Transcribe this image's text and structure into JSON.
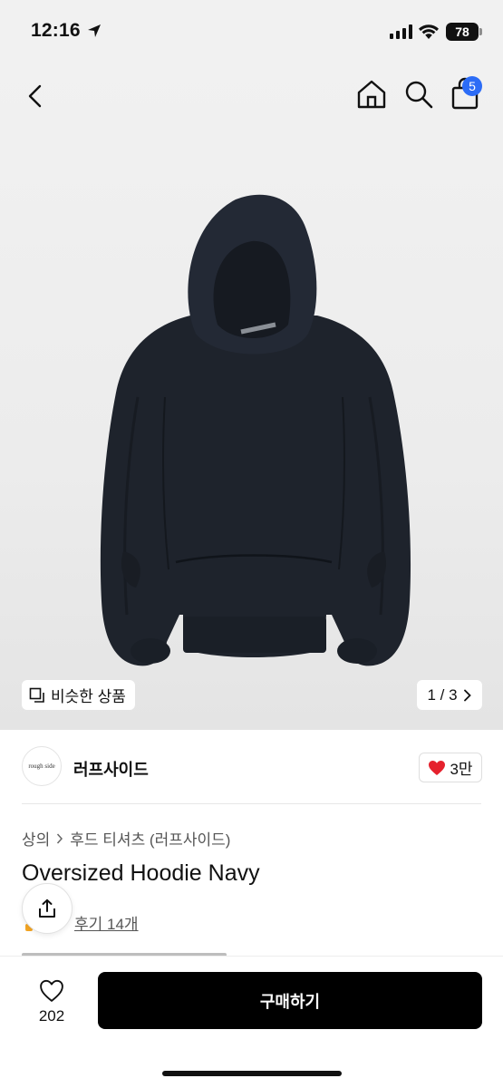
{
  "status_bar": {
    "time": "12:16",
    "battery": "78"
  },
  "nav": {
    "cart_count": "5"
  },
  "gallery": {
    "similar_label": "비슷한 상품",
    "page_indicator": "1 / 3"
  },
  "store": {
    "logo_text": "rough side",
    "name": "러프사이드",
    "likes": "3만"
  },
  "product": {
    "breadcrumb": [
      "상의",
      "후드 티셔츠 (러프사이드)"
    ],
    "title": "Oversized Hoodie Navy",
    "review_link": "후기 14개"
  },
  "bottom_bar": {
    "wish_count": "202",
    "buy_label": "구매하기"
  },
  "colors": {
    "accent_blue": "#2c6cf6",
    "heart_red": "#e5212d",
    "hoodie_navy": "#1e232c",
    "buy_button": "#000000"
  },
  "icons": [
    "back-icon",
    "home-icon",
    "search-icon",
    "cart-icon",
    "similar-icon",
    "chevron-right-icon",
    "heart-filled-icon",
    "share-icon",
    "heart-outline-icon"
  ]
}
